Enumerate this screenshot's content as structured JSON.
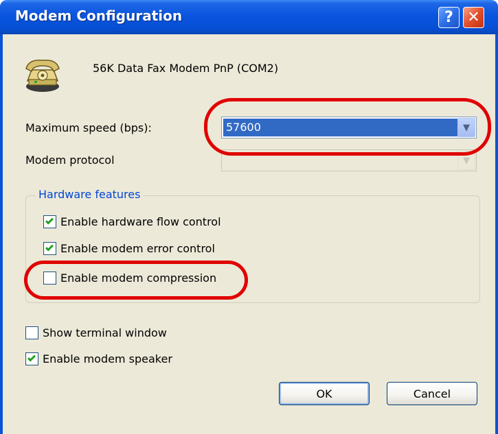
{
  "window": {
    "title": "Modem Configuration",
    "help_glyph": "?",
    "close_glyph": "✕"
  },
  "device": {
    "name": "56K Data Fax Modem PnP (COM2)",
    "icon": "telephone-modem-icon"
  },
  "speed": {
    "label": "Maximum speed (bps):",
    "value": "57600"
  },
  "protocol": {
    "label": "Modem protocol",
    "value": ""
  },
  "hardware": {
    "title": "Hardware features",
    "items": [
      {
        "label": "Enable hardware flow control",
        "checked": true
      },
      {
        "label": "Enable modem error control",
        "checked": true
      },
      {
        "label": "Enable modem compression",
        "checked": false
      }
    ]
  },
  "options": [
    {
      "label": "Show terminal window",
      "checked": false
    },
    {
      "label": "Enable modem speaker",
      "checked": true
    }
  ],
  "buttons": {
    "ok": "OK",
    "cancel": "Cancel"
  },
  "colors": {
    "titlebar": "#0a53d8",
    "face": "#ece9d8",
    "selection": "#316ac5",
    "highlight": "#e00000",
    "group_title": "#0046d5"
  }
}
